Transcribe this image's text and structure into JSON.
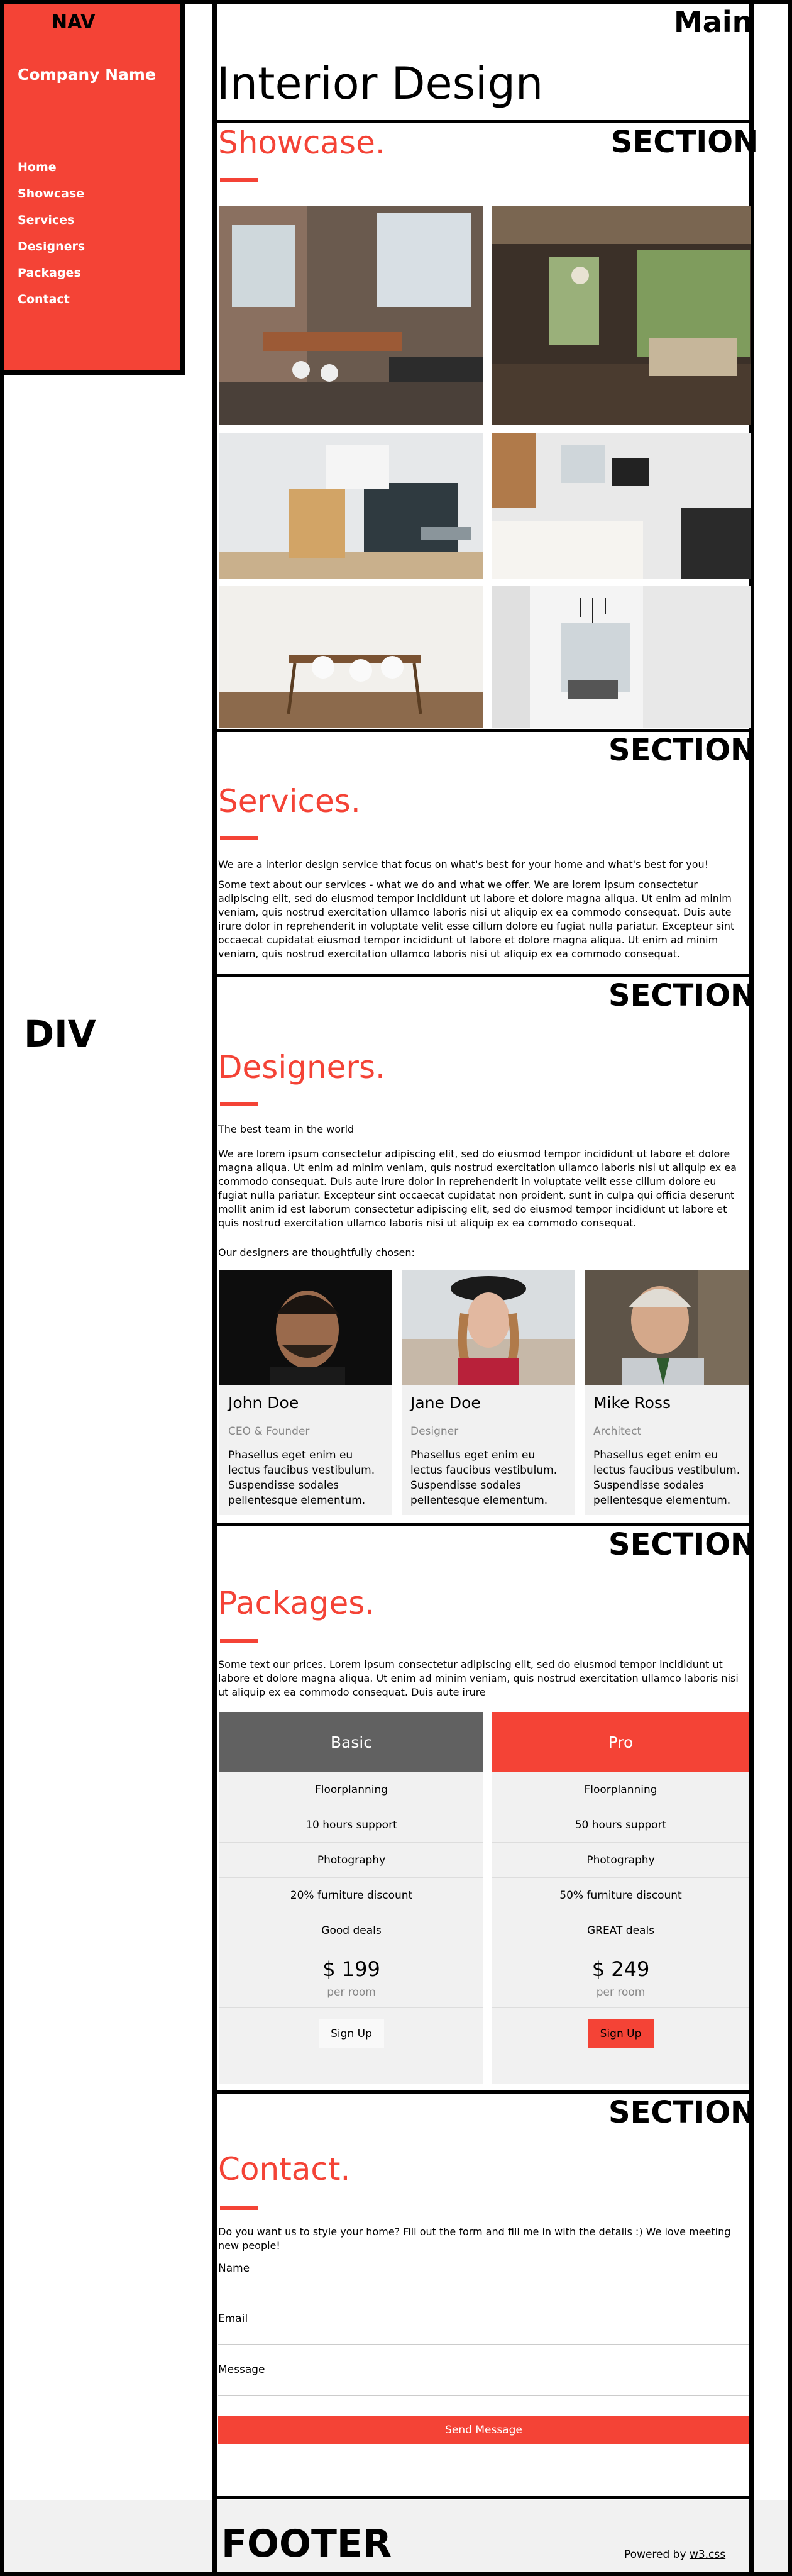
{
  "nav": {
    "label": "NAV",
    "company": "Company Name",
    "links": [
      "Home",
      "Showcase",
      "Services",
      "Designers",
      "Packages",
      "Contact"
    ]
  },
  "div_label": "DIV",
  "main": {
    "label": "Main",
    "title": "Interior Design"
  },
  "section_label": "SECTION",
  "showcase": {
    "title": "Showcase."
  },
  "services": {
    "title": "Services.",
    "intro": "We are a interior design service that focus on what's best for your home and what's best for you!",
    "body": "Some text about our services - what we do and what we offer. We are lorem ipsum consectetur adipiscing elit, sed do eiusmod tempor incididunt ut labore et dolore magna aliqua. Ut enim ad minim veniam, quis nostrud exercitation ullamco laboris nisi ut aliquip ex ea commodo consequat. Duis aute irure dolor in reprehenderit in voluptate velit esse cillum dolore eu fugiat nulla pariatur. Excepteur sint occaecat cupidatat eiusmod tempor incididunt ut labore et dolore magna aliqua. Ut enim ad minim veniam, quis nostrud exercitation ullamco laboris nisi ut aliquip ex ea commodo consequat."
  },
  "designers": {
    "title": "Designers.",
    "subtitle": "The best team in the world",
    "body": "We are lorem ipsum consectetur adipiscing elit, sed do eiusmod tempor incididunt ut labore et dolore magna aliqua. Ut enim ad minim veniam, quis nostrud exercitation ullamco laboris nisi ut aliquip ex ea commodo consequat. Duis aute irure dolor in reprehenderit in voluptate velit esse cillum dolore eu fugiat nulla pariatur. Excepteur sint occaecat cupidatat non proident, sunt in culpa qui officia deserunt mollit anim id est laborum consectetur adipiscing elit, sed do eiusmod tempor incididunt ut labore et quis nostrud exercitation ullamco laboris nisi ut aliquip ex ea commodo consequat.",
    "chosen": "Our designers are thoughtfully chosen:",
    "people": [
      {
        "name": "John Doe",
        "role": "CEO & Founder",
        "desc": "Phasellus eget enim eu lectus faucibus vestibulum. Suspendisse sodales pellentesque elementum."
      },
      {
        "name": "Jane Doe",
        "role": "Designer",
        "desc": "Phasellus eget enim eu lectus faucibus vestibulum. Suspendisse sodales pellentesque elementum."
      },
      {
        "name": "Mike Ross",
        "role": "Architect",
        "desc": "Phasellus eget enim eu lectus faucibus vestibulum. Suspendisse sodales pellentesque elementum."
      }
    ]
  },
  "packages": {
    "title": "Packages.",
    "body": "Some text our prices. Lorem ipsum consectetur adipiscing elit, sed do eiusmod tempor incididunt ut labore et dolore magna aliqua. Ut enim ad minim veniam, quis nostrud exercitation ullamco laboris nisi ut aliquip ex ea commodo consequat. Duis aute irure",
    "plans": [
      {
        "name": "Basic",
        "features": [
          "Floorplanning",
          "10 hours support",
          "Photography",
          "20% furniture discount",
          "Good deals"
        ],
        "price": "$ 199",
        "per": "per room",
        "button": "Sign Up"
      },
      {
        "name": "Pro",
        "features": [
          "Floorplanning",
          "50 hours support",
          "Photography",
          "50% furniture discount",
          "GREAT deals"
        ],
        "price": "$ 249",
        "per": "per room",
        "button": "Sign Up"
      }
    ]
  },
  "contact": {
    "title": "Contact.",
    "intro": "Do you want us to style your home? Fill out the form and fill me in with the details :) We love meeting new people!",
    "fields": [
      "Name",
      "Email",
      "Message"
    ],
    "button": "Send Message"
  },
  "footer": {
    "label": "FOOTER",
    "powered_prefix": "Powered by ",
    "powered_link": "w3.css"
  },
  "colors": {
    "accent": "#f44336",
    "basic_header": "#616161",
    "card_bg": "#f1f1f1"
  }
}
